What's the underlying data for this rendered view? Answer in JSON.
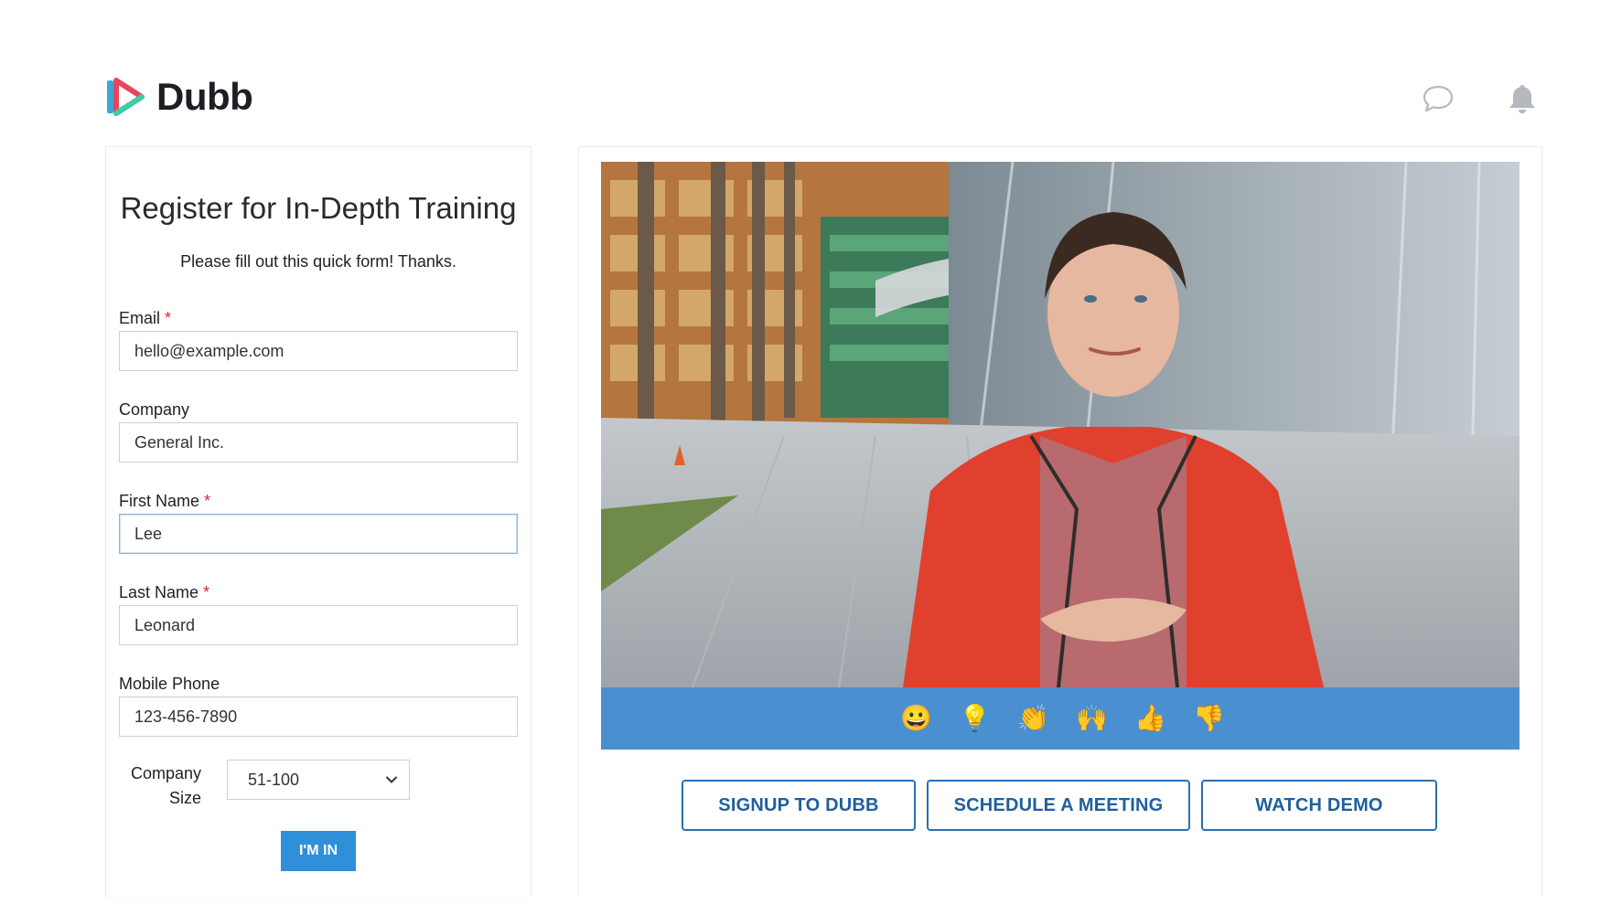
{
  "brand": {
    "name": "Dubb"
  },
  "header": {
    "icons": [
      "chat-bubble-icon",
      "bell-icon"
    ]
  },
  "form": {
    "title": "Register for In-Depth Training",
    "subtitle": "Please fill out this quick form! Thanks.",
    "fields": {
      "email": {
        "label": "Email",
        "required": "*",
        "value": "hello@example.com"
      },
      "company": {
        "label": "Company",
        "value": "General Inc."
      },
      "first_name": {
        "label": "First Name",
        "required": "*",
        "value": "Lee"
      },
      "last_name": {
        "label": "Last Name",
        "required": "*",
        "value": "Leonard"
      },
      "mobile_phone": {
        "label": "Mobile Phone",
        "value": "123-456-7890"
      }
    },
    "company_size": {
      "label_line1": "Company",
      "label_line2": "Size",
      "selected": "51-100"
    },
    "submit_label": "I'M IN"
  },
  "video": {
    "reactions": [
      "😀",
      "💡",
      "👏",
      "🙌",
      "👍",
      "👎"
    ],
    "reaction_names": [
      "grinning-face-icon",
      "light-bulb-icon",
      "clapping-hands-icon",
      "raised-hands-icon",
      "thumbs-up-icon",
      "thumbs-down-icon"
    ]
  },
  "cta": {
    "signup": "SIGNUP TO DUBB",
    "schedule": "SCHEDULE A MEETING",
    "demo": "WATCH DEMO"
  },
  "colors": {
    "accent_blue": "#2f8fd8",
    "reaction_bar": "#4a90d0",
    "cta_border": "#2a6fb0",
    "required_star": "#d9262f"
  }
}
